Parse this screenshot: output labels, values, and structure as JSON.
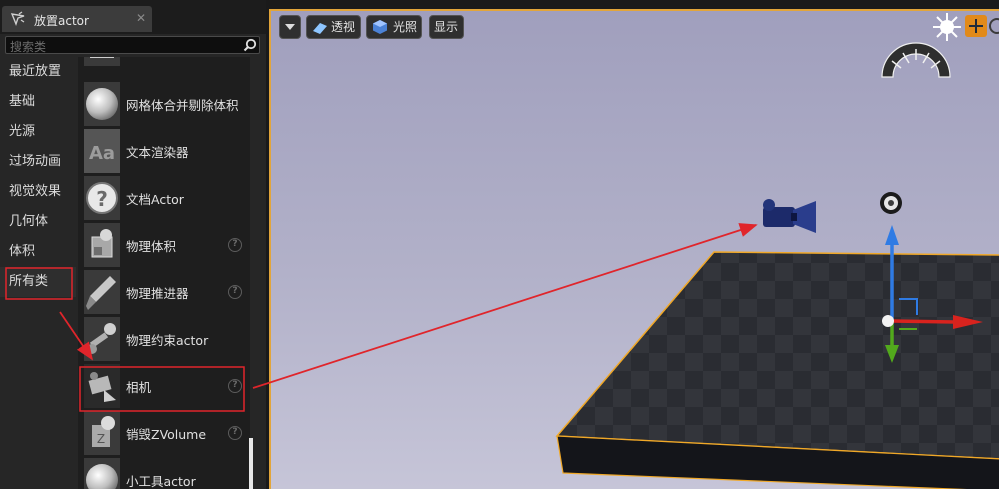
{
  "panel": {
    "tab_title": "放置actor",
    "tab_close": "✕",
    "search_placeholder": "搜索类"
  },
  "categories": [
    {
      "label": "最近放置"
    },
    {
      "label": "基础"
    },
    {
      "label": "光源"
    },
    {
      "label": "过场动画"
    },
    {
      "label": "视觉效果"
    },
    {
      "label": "几何体"
    },
    {
      "label": "体积"
    },
    {
      "label": "所有类",
      "selected": true
    }
  ],
  "items": [
    {
      "label": "网格体合并剔除体积",
      "has_help": false
    },
    {
      "label": "文本渲染器",
      "has_help": false
    },
    {
      "label": "文档Actor",
      "has_help": false
    },
    {
      "label": "物理体积",
      "has_help": true
    },
    {
      "label": "物理推进器",
      "has_help": true
    },
    {
      "label": "物理约束actor",
      "has_help": false
    },
    {
      "label": "相机",
      "has_help": true,
      "highlighted": true
    },
    {
      "label": "销毁ZVolume",
      "has_help": true
    },
    {
      "label": "小工具actor",
      "has_help": false
    }
  ],
  "help_glyph": "?",
  "viewport": {
    "toolbar": {
      "perspective_label": "透视",
      "lit_label": "光照",
      "show_label": "显示"
    }
  },
  "colors": {
    "highlight_box": "#e0252b",
    "selection_outline": "#f0a828",
    "floor": "#2b2d33",
    "gizmo_x": "#d8231e",
    "gizmo_y": "#52a91c",
    "gizmo_z": "#2f7be4",
    "camera_body": "#1c2a6a"
  }
}
